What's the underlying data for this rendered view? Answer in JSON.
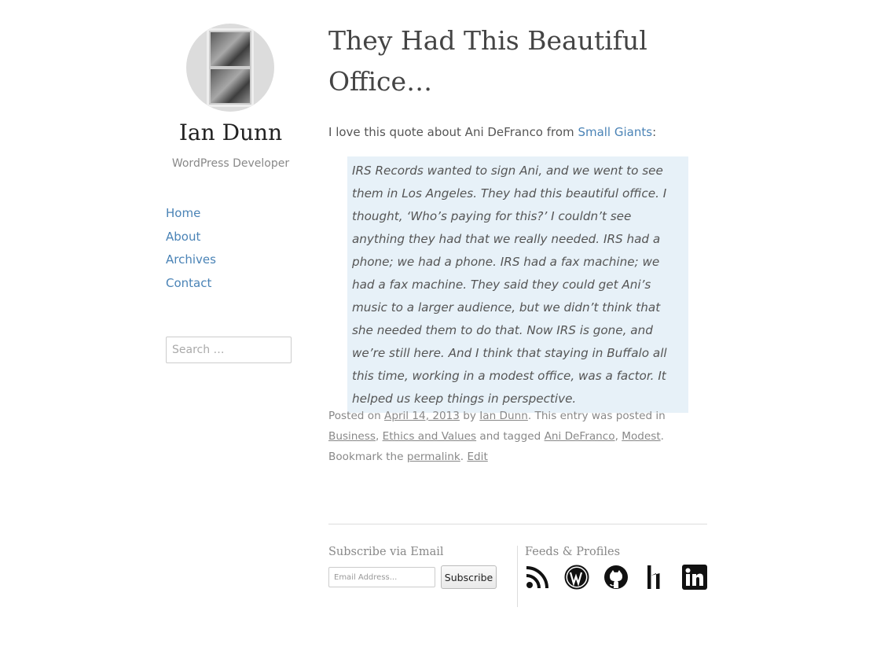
{
  "site": {
    "title": "Ian Dunn",
    "tagline": "WordPress Developer"
  },
  "nav": {
    "items": [
      {
        "label": "Home"
      },
      {
        "label": "About"
      },
      {
        "label": "Archives"
      },
      {
        "label": "Contact"
      }
    ]
  },
  "search": {
    "placeholder": "Search …"
  },
  "post": {
    "title": "They Had This Beautiful Office…",
    "intro_text": "I love this quote about Ani DeFranco from ",
    "intro_link": "Small Giants",
    "intro_suffix": ":",
    "quote": "IRS Records wanted to sign Ani, and we went to see them in Los Angeles. They had this beautiful office. I thought, ‘Who’s paying for this?’ I couldn’t see anything they had that we really needed. IRS had a phone; we had a phone. IRS had a fax machine; we had a fax machine. They said they could get Ani’s music to a larger audience, but we didn’t think that she needed them to do that. Now IRS is gone, and we’re still here. And I think that staying in Buffalo all this time, working in a modest office, was a factor. It helped us keep things in perspective.",
    "meta": {
      "posted_on": "Posted on ",
      "date": "April 14, 2013",
      "by": " by ",
      "author": "Ian Dunn",
      "posted_in": ". This entry was posted in ",
      "cat1": "Business",
      "comma1": ", ",
      "cat2": "Ethics and Values",
      "tagged": " and tagged ",
      "tag1": "Ani DeFranco",
      "comma2": ", ",
      "tag2": "Modest",
      "bookmark": ". Bookmark the ",
      "permalink": "permalink",
      "period": ". ",
      "edit": "Edit"
    }
  },
  "footer": {
    "subscribe_title": "Subscribe via Email",
    "email_placeholder": "Email Address...",
    "subscribe_button": "Subscribe",
    "feeds_title": "Feeds & Profiles",
    "icons": [
      "rss-icon",
      "wordpress-icon",
      "github-icon",
      "hackerone-icon",
      "linkedin-icon"
    ]
  },
  "colors": {
    "link": "#4a83b6",
    "quote_bg": "#e7f1f8",
    "text": "#555555",
    "muted": "#888888"
  }
}
